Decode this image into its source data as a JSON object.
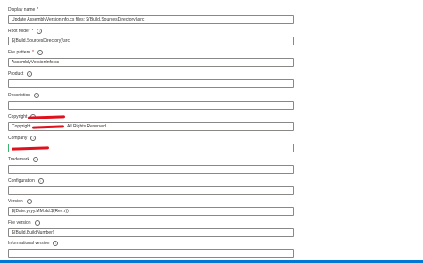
{
  "fields": [
    {
      "label": "Display name",
      "required": true,
      "info": false,
      "value": "Update AssemblyVersionInfo.cs files: $(Build.SourcesDirectory)\\src"
    },
    {
      "label": "Root folder",
      "required": true,
      "info": true,
      "value": "$(Build.SourcesDirectory)\\src"
    },
    {
      "label": "File pattern",
      "required": true,
      "info": true,
      "value": "AssemblyVersionInfo.cs"
    },
    {
      "label": "Product",
      "required": false,
      "info": true,
      "value": ""
    },
    {
      "label": "Description",
      "required": false,
      "info": true,
      "value": ""
    },
    {
      "label": "Copyright",
      "required": false,
      "info": true,
      "value": "Copyright",
      "value_suffix": "All Rights Reserved."
    },
    {
      "label": "Company",
      "required": false,
      "info": true,
      "value": ""
    },
    {
      "label": "Trademark",
      "required": false,
      "info": true,
      "value": ""
    },
    {
      "label": "Configuration",
      "required": false,
      "info": true,
      "value": ""
    },
    {
      "label": "Version",
      "required": false,
      "info": true,
      "value": "$(Date:yyyy.MM.dd.$(Rev:r))"
    },
    {
      "label": "File version",
      "required": false,
      "info": true,
      "value": "$(Build.BuildNumber)"
    },
    {
      "label": "Informational version",
      "required": false,
      "info": true,
      "value": ""
    }
  ],
  "colors": {
    "accent": "#0078d4",
    "redaction": "#e0101c"
  }
}
